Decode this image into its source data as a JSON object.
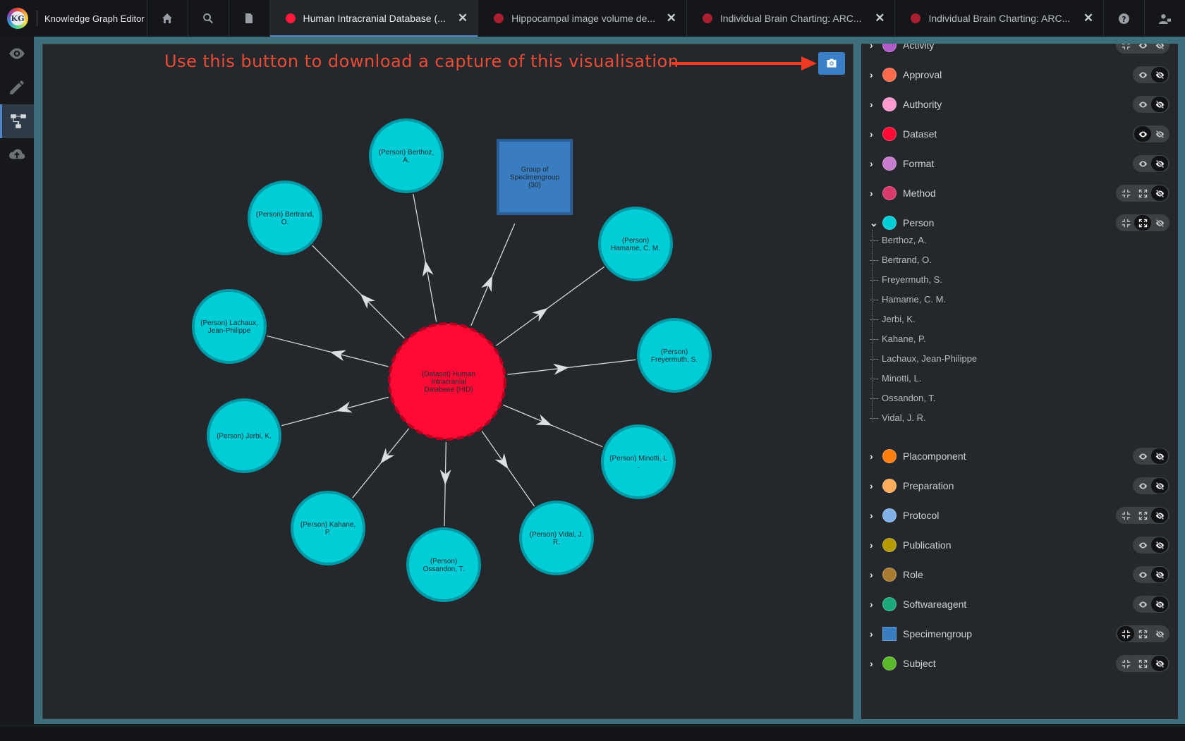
{
  "app": {
    "logo_text": "KG",
    "title": "Knowledge Graph Editor"
  },
  "tabs": [
    {
      "label": "Human Intracranial Database (...",
      "color": "#ff1a3c",
      "active": true
    },
    {
      "label": "Hippocampal image volume de...",
      "color": "#a8202f",
      "active": false
    },
    {
      "label": "Individual Brain Charting: ARC...",
      "color": "#a8202f",
      "active": false
    },
    {
      "label": "Individual Brain Charting: ARC...",
      "color": "#a8202f",
      "active": false
    }
  ],
  "annotation": {
    "text": "Use this button to download a capture of this visualisation",
    "color": "#ee4b35"
  },
  "capture_button": {
    "icon": "camera-icon",
    "color": "#3a7fc8"
  },
  "graph": {
    "center": {
      "label": [
        "(Dataset) Human",
        "Intracranial",
        "Database (HID)"
      ],
      "color": "#ff0a35"
    },
    "group": {
      "label": [
        "Group of",
        "Specimengroup",
        "(30)"
      ],
      "color": "#3a7cc0"
    },
    "persons": [
      {
        "label": [
          "(Person) Berthoz,",
          "A."
        ]
      },
      {
        "label": [
          "(Person) Bertrand,",
          "O."
        ]
      },
      {
        "label": [
          "(Person) Lachaux,",
          "Jean-Philippe"
        ]
      },
      {
        "label": [
          "(Person) Jerbi, K."
        ]
      },
      {
        "label": [
          "(Person) Kahane,",
          "P."
        ]
      },
      {
        "label": [
          "(Person)",
          "Ossandon, T."
        ]
      },
      {
        "label": [
          "(Person) Vidal, J.",
          "R."
        ]
      },
      {
        "label": [
          "(Person) Minotti, L",
          "."
        ]
      },
      {
        "label": [
          "(Person)",
          "Freyermuth, S."
        ]
      },
      {
        "label": [
          "(Person)",
          "Hamame, C. M."
        ]
      }
    ],
    "person_color": "#00cdd6"
  },
  "types": [
    {
      "label": "Activity",
      "color": "#b05cc8",
      "partial": true
    },
    {
      "label": "Approval",
      "color": "#ff6a4d"
    },
    {
      "label": "Authority",
      "color": "#ff9ad0"
    },
    {
      "label": "Dataset",
      "color": "#ff0a35"
    },
    {
      "label": "Format",
      "color": "#c77ccf"
    },
    {
      "label": "Method",
      "color": "#d83a6a"
    },
    {
      "label": "Person",
      "color": "#00cdd6",
      "expanded": true
    },
    {
      "label": "Placomponent",
      "color": "#ff7f0e"
    },
    {
      "label": "Preparation",
      "color": "#ffad5a"
    },
    {
      "label": "Protocol",
      "color": "#7fb1e8"
    },
    {
      "label": "Publication",
      "color": "#b59a00"
    },
    {
      "label": "Role",
      "color": "#a87b30"
    },
    {
      "label": "Softwareagent",
      "color": "#1aa87a"
    },
    {
      "label": "Specimengroup",
      "color": "#3a7cc0",
      "square": true
    },
    {
      "label": "Subject",
      "color": "#5ab82a"
    }
  ],
  "person_children": [
    "Berthoz, A.",
    "Bertrand, O.",
    "Freyermuth, S.",
    "Hamame, C. M.",
    "Jerbi, K.",
    "Kahane, P.",
    "Lachaux, Jean-Philippe",
    "Minotti, L.",
    "Ossandon, T.",
    "Vidal, J. R."
  ]
}
